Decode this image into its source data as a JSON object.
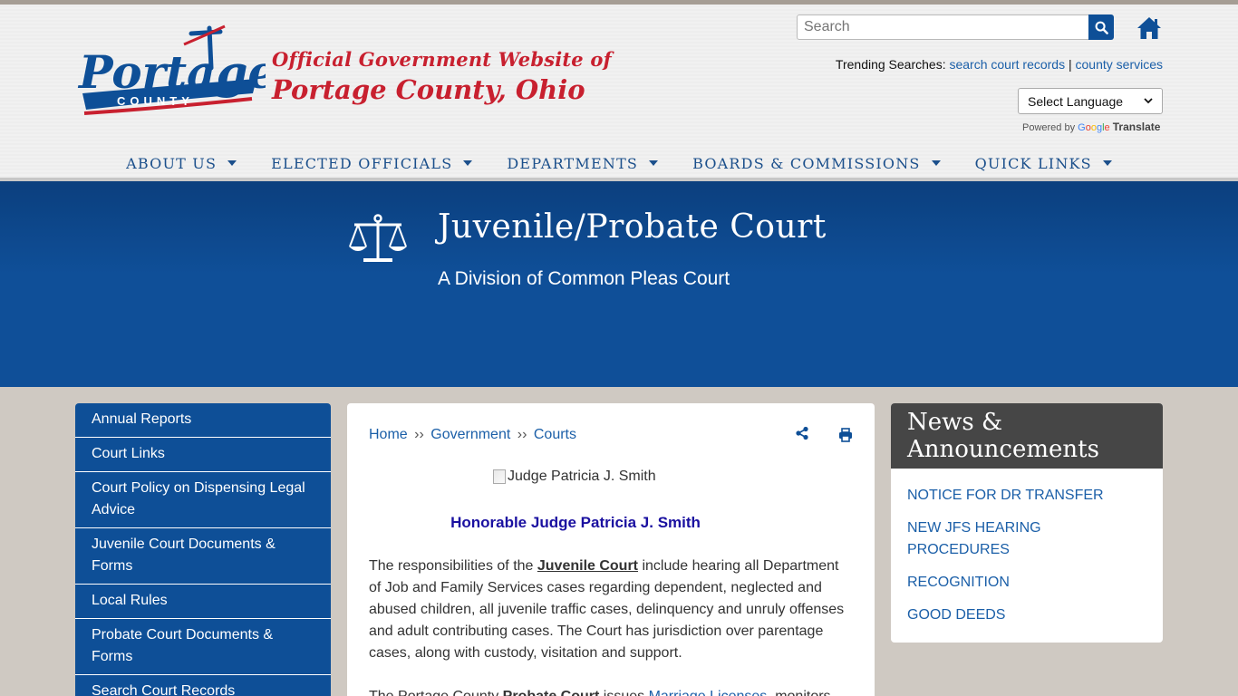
{
  "header": {
    "logo_word": "Portage",
    "logo_sub": "COUNTY",
    "tagline_line1": "Official Government Website of",
    "tagline_line2": "Portage County, Ohio",
    "search_placeholder": "Search",
    "trending_label": "Trending Searches:",
    "trending_links": [
      "search court records",
      "county services"
    ],
    "trending_sep": "|",
    "language_select": "Select Language",
    "powered_by": "Powered by",
    "translate": "Translate"
  },
  "nav": [
    "ABOUT US",
    "ELECTED OFFICIALS",
    "DEPARTMENTS",
    "BOARDS & COMMISSIONS",
    "QUICK LINKS"
  ],
  "banner": {
    "title": "Juvenile/Probate Court",
    "subtitle": "A Division of Common Pleas Court"
  },
  "sidebar": [
    "Annual Reports",
    "Court Links",
    "Court Policy on Dispensing Legal Advice",
    "Juvenile Court Documents & Forms",
    "Local Rules",
    "Probate Court Documents & Forms",
    "Search Court Records"
  ],
  "breadcrumb": {
    "items": [
      "Home",
      "Government",
      "Courts"
    ],
    "sep": "››"
  },
  "content": {
    "image_alt": "Judge Patricia J. Smith",
    "judge_heading": "Honorable Judge Patricia J. Smith",
    "para1_a": "The responsibilities of the ",
    "para1_link": "Juvenile Court",
    "para1_b": " include hearing all Department of Job and Family Services cases regarding dependent, neglected and abused children, all juvenile traffic cases, delinquency and unruly offenses and adult contributing cases. The Court has jurisdiction over parentage cases, along with custody, visitation and support.",
    "para2_a": "The Portage County ",
    "para2_bold": "Probate Court",
    "para2_b": " issues ",
    "para2_link": "Marriage Licenses",
    "para2_c": ", monitors"
  },
  "news": {
    "title": "News & Announcements",
    "items": [
      "NOTICE FOR DR TRANSFER",
      "NEW JFS HEARING PROCEDURES",
      "RECOGNITION",
      "GOOD DEEDS"
    ]
  },
  "colors": {
    "brand_blue": "#0e4f97",
    "brand_red": "#c8202f",
    "link_blue": "#1b5fa8"
  }
}
